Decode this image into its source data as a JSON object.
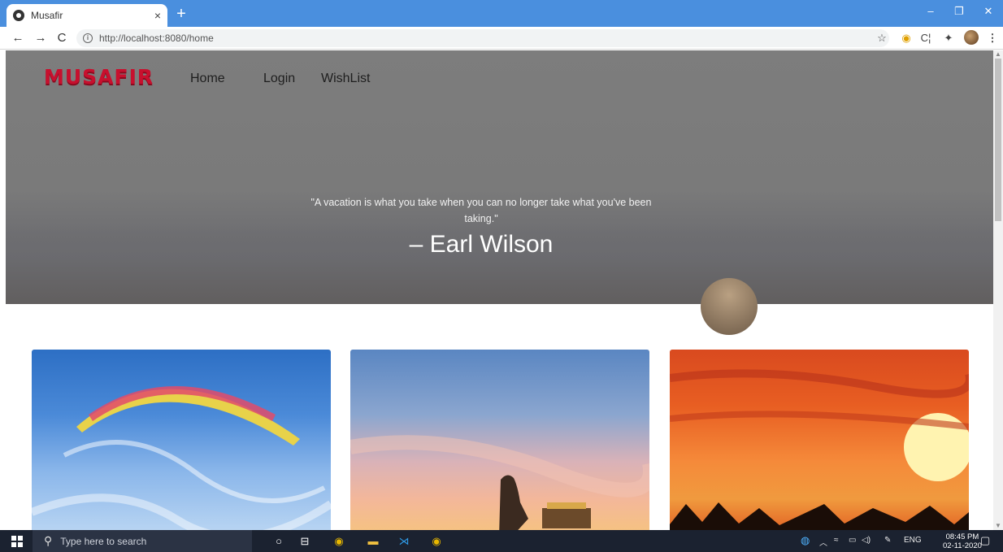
{
  "browser": {
    "tab_title": "Musafir",
    "tab_close": "×",
    "new_tab": "+",
    "url": "http://localhost:8080/home",
    "window_controls": {
      "minimize": "–",
      "restore": "❐",
      "close": "✕"
    },
    "nav": {
      "back": "←",
      "forward": "→",
      "reload": "C"
    },
    "extensions": {
      "star": "☆",
      "ext1": "◉",
      "ext2": "C¦",
      "puzzle": "✦",
      "menu": "⋮"
    }
  },
  "site": {
    "brand": "MUSAFIR",
    "nav_items": [
      "Home",
      "Login",
      "WishList"
    ],
    "quote": "\"A vacation is what you take when you can no longer take what you've been taking.\"",
    "author": "– Earl Wilson"
  },
  "taskbar": {
    "search_placeholder": "Type here to search",
    "language": "ENG",
    "time": "08:45 PM",
    "date": "02-11-2020"
  }
}
